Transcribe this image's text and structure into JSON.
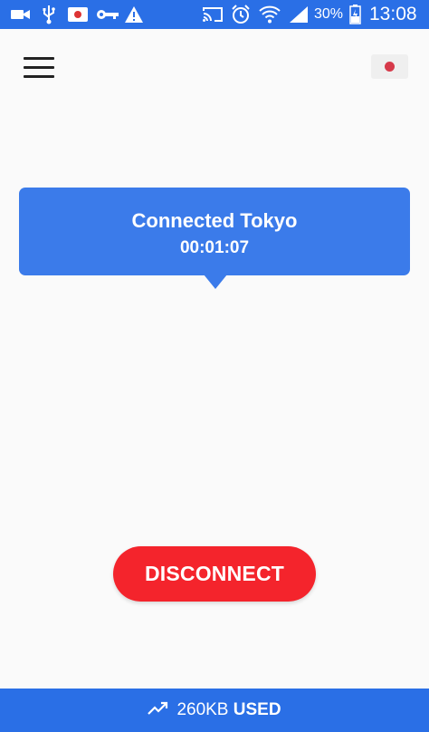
{
  "status_bar": {
    "battery_percent": "30%",
    "time": "13:08",
    "left_icons": [
      "video-icon",
      "usb-icon",
      "screen-record-icon",
      "vpn-key-icon",
      "warning-icon"
    ],
    "right_icons": [
      "cast-icon",
      "alarm-icon",
      "wifi-icon",
      "signal-icon",
      "battery-charging-icon"
    ]
  },
  "header": {
    "menu_icon": "hamburger-menu-icon",
    "server_flag": "japan-flag-icon"
  },
  "connection": {
    "status": "Connected Tokyo",
    "timer": "00:01:07"
  },
  "actions": {
    "disconnect_label": "DISCONNECT",
    "disconnect_color": "#f4242c"
  },
  "usage": {
    "icon": "trending-up-icon",
    "amount": "260KB",
    "suffix": "USED"
  },
  "colors": {
    "accent": "#2a6fe6",
    "card": "#3b7bea",
    "danger": "#f4242c"
  }
}
